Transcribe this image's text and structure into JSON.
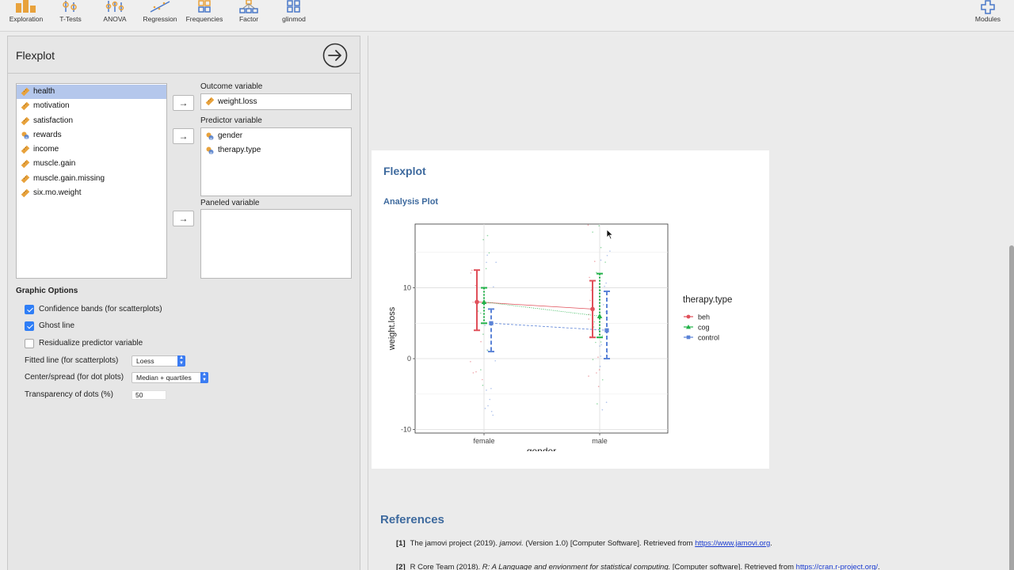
{
  "toolbar": {
    "items": [
      "Exploration",
      "T-Tests",
      "ANOVA",
      "Regression",
      "Frequencies",
      "Factor",
      "glinmod"
    ],
    "modules": "Modules"
  },
  "options": {
    "title": "Flexplot",
    "variables": [
      {
        "name": "health",
        "icon": "continuous-ruler-icon"
      },
      {
        "name": "motivation",
        "icon": "continuous-ruler-icon"
      },
      {
        "name": "satisfaction",
        "icon": "continuous-ruler-icon"
      },
      {
        "name": "rewards",
        "icon": "nominal-venn-icon"
      },
      {
        "name": "income",
        "icon": "continuous-ruler-icon"
      },
      {
        "name": "muscle.gain",
        "icon": "continuous-ruler-icon"
      },
      {
        "name": "muscle.gain.missing",
        "icon": "continuous-ruler-icon"
      },
      {
        "name": "six.mo.weight",
        "icon": "continuous-ruler-icon"
      }
    ],
    "outcome_label": "Outcome variable",
    "outcome_value": "weight.loss",
    "predictor_label": "Predictor variable",
    "predictors": [
      "gender",
      "therapy.type"
    ],
    "paneled_label": "Paneled variable",
    "arrow": "→",
    "graphic_options_label": "Graphic Options",
    "checks": [
      {
        "label": "Confidence bands (for scatterplots)",
        "checked": true
      },
      {
        "label": "Ghost line",
        "checked": true
      },
      {
        "label": "Residualize predictor variable",
        "checked": false
      }
    ],
    "fitted_line_label": "Fitted line (for scatterplots)",
    "fitted_line_value": "Loess",
    "center_spread_label": "Center/spread (for dot plots)",
    "center_spread_value": "Median + quartiles",
    "transparency_label": "Transparency of dots (%)",
    "transparency_value": "50"
  },
  "results": {
    "title": "Flexplot",
    "subtitle": "Analysis Plot",
    "references_title": "References",
    "references": [
      {
        "num": "[1]",
        "pre": "The jamovi project (2019). ",
        "italic": "jamovi.",
        "post": " (Version 1.0) [Computer Software]. Retrieved from ",
        "link": "https://www.jamovi.org",
        "end": "."
      },
      {
        "num": "[2]",
        "pre": "R Core Team (2018). ",
        "italic": "R: A Language and envionment for statistical computing.",
        "post": " [Computer software]. Retrieved from ",
        "link": "https://cran.r-project.org/",
        "end": "."
      }
    ]
  },
  "chart_data": {
    "type": "scatter",
    "xlabel": "gender",
    "ylabel": "weight.loss",
    "categories": [
      "female",
      "male"
    ],
    "yticks": [
      -10,
      0,
      10
    ],
    "ylim": [
      -10.5,
      19
    ],
    "legend_title": "therapy.type",
    "legend_position": "right",
    "grid": true,
    "series": [
      {
        "name": "beh",
        "color": "#e0505a",
        "marker": "circle",
        "line": "solid",
        "center": [
          8,
          7
        ],
        "lower": [
          4,
          3
        ],
        "upper": [
          12.5,
          11
        ]
      },
      {
        "name": "cog",
        "color": "#23b24a",
        "marker": "triangle",
        "line": "dotted",
        "center": [
          8,
          6
        ],
        "lower": [
          5,
          3
        ],
        "upper": [
          10,
          12
        ]
      },
      {
        "name": "control",
        "color": "#5b83d7",
        "marker": "square",
        "line": "dashed",
        "center": [
          5,
          4
        ],
        "lower": [
          1,
          0
        ],
        "upper": [
          7,
          9.5
        ]
      }
    ]
  }
}
